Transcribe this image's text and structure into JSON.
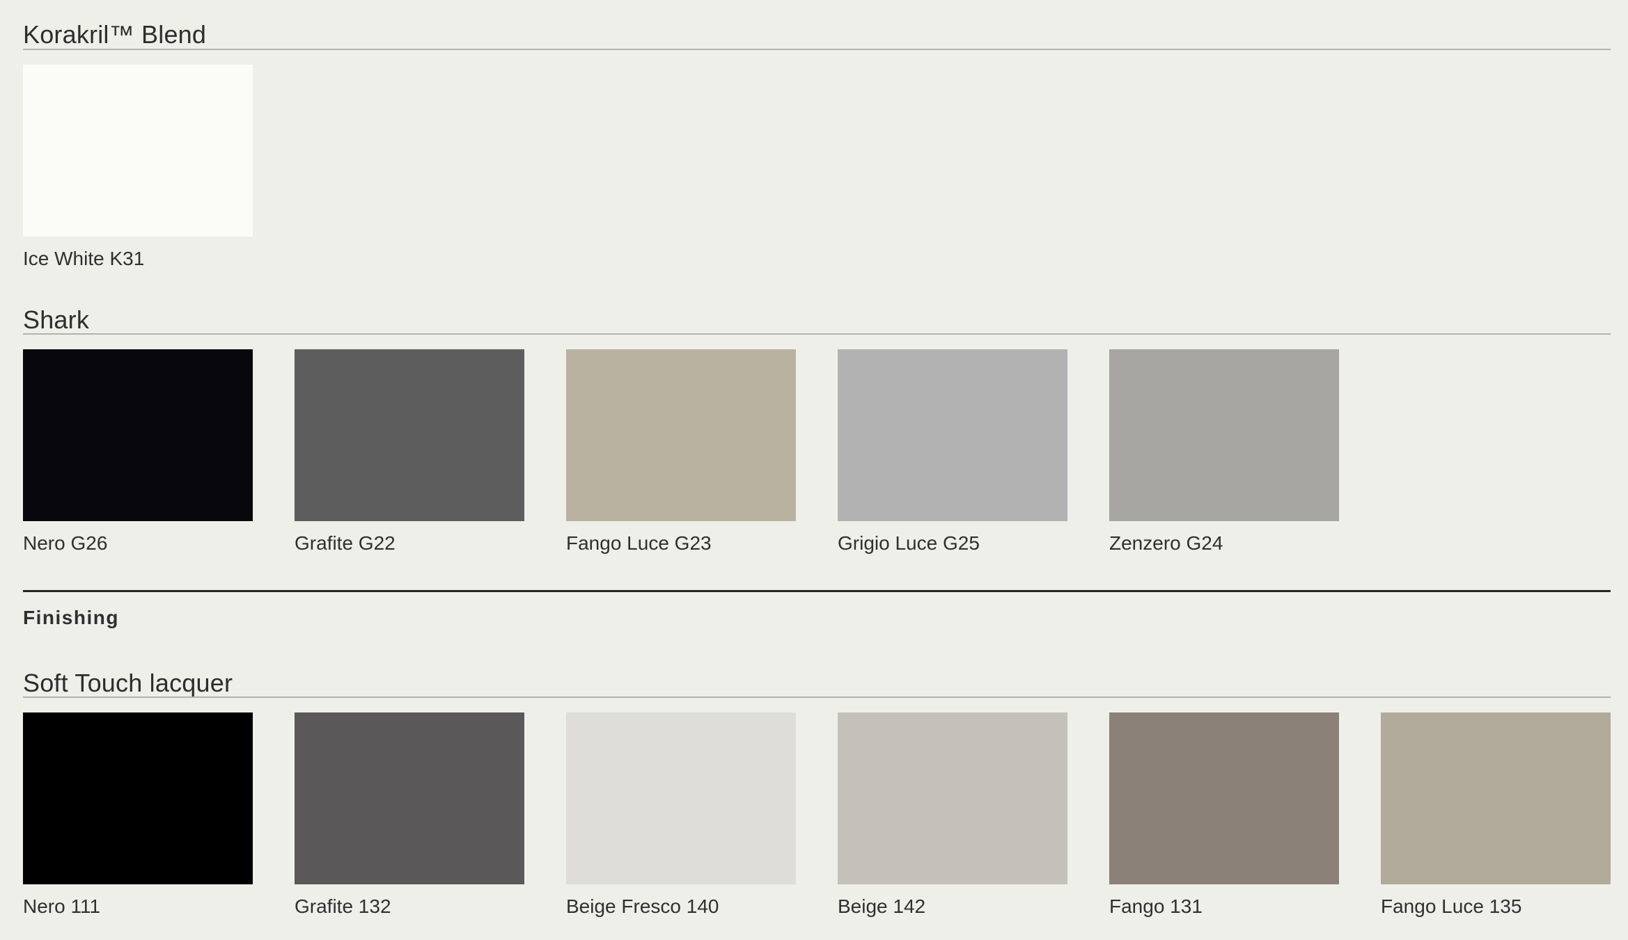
{
  "sections": {
    "korakril": {
      "title": "Korakril™ Blend",
      "swatches": [
        {
          "label": "Ice White K31",
          "color": "#fbfcf7"
        }
      ]
    },
    "shark": {
      "title": "Shark",
      "swatches": [
        {
          "label": "Nero G26",
          "color": "#08080c"
        },
        {
          "label": "Grafite G22",
          "color": "#5d5d5d"
        },
        {
          "label": "Fango Luce G23",
          "color": "#b9b2a1"
        },
        {
          "label": "Grigio Luce G25",
          "color": "#b2b2b2"
        },
        {
          "label": "Zenzero G24",
          "color": "#a6a5a1"
        }
      ]
    },
    "finishing": {
      "label": "Finishing"
    },
    "soft_touch": {
      "title": "Soft Touch lacquer",
      "swatches": [
        {
          "label": "Nero 111",
          "color": "#000000"
        },
        {
          "label": "Grafite 132",
          "color": "#5b5859"
        },
        {
          "label": "Beige Fresco 140",
          "color": "#deddd8"
        },
        {
          "label": "Beige 142",
          "color": "#c3c1ba"
        },
        {
          "label": "Fango 131",
          "color": "#8b8178"
        },
        {
          "label": "Fango Luce 135",
          "color": "#b1aa9a"
        }
      ]
    }
  }
}
